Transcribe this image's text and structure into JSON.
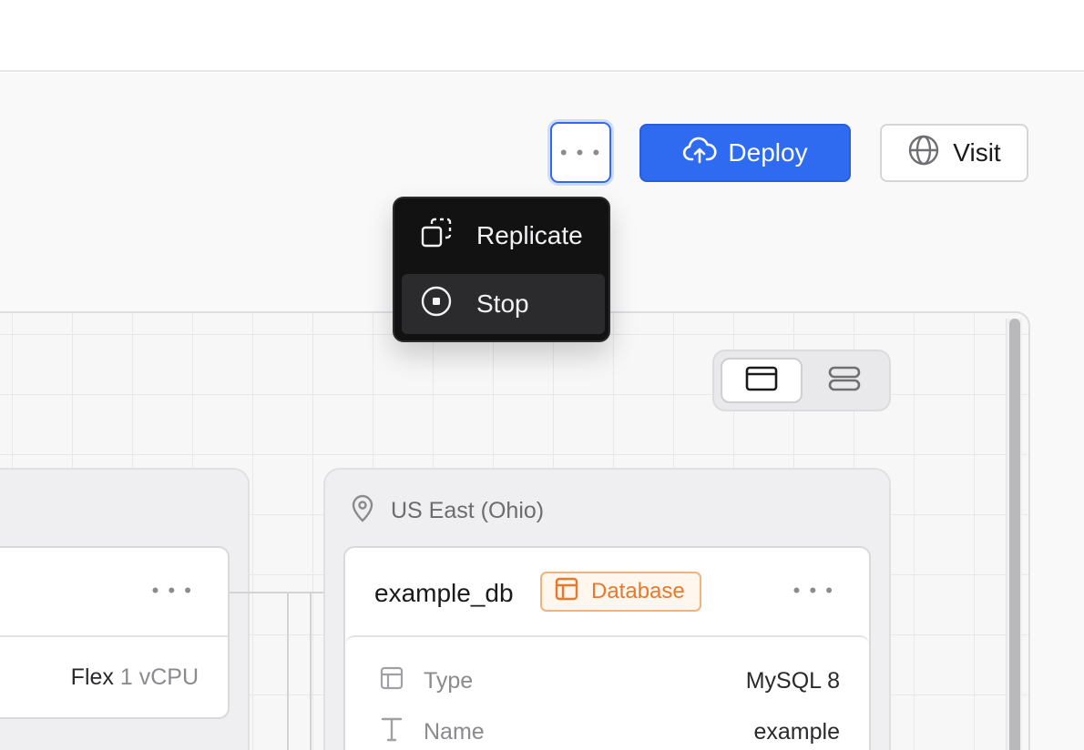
{
  "toolbar": {
    "more_label": "• • •",
    "deploy_label": "Deploy",
    "visit_label": "Visit"
  },
  "menu": {
    "items": [
      {
        "label": "Replicate",
        "icon": "replicate-icon"
      },
      {
        "label": "Stop",
        "icon": "stop-icon"
      }
    ]
  },
  "view_toggle": {
    "options": [
      {
        "icon": "card-view-icon",
        "active": true
      },
      {
        "icon": "list-view-icon",
        "active": false
      }
    ]
  },
  "left_service": {
    "menu_label": "• • •",
    "plan_name": "Flex",
    "plan_size": "1 vCPU"
  },
  "region": {
    "label": "US East (Ohio)"
  },
  "database": {
    "name": "example_db",
    "badge": "Database",
    "menu_label": "• • •",
    "details": [
      {
        "label": "Type",
        "value": "MySQL 8",
        "icon": "table-icon"
      },
      {
        "label": "Name",
        "value": "example",
        "icon": "text-icon"
      }
    ]
  },
  "colors": {
    "accent": "#2f6bf0",
    "badge_orange": "#e9782a",
    "menu_bg": "#121213"
  }
}
